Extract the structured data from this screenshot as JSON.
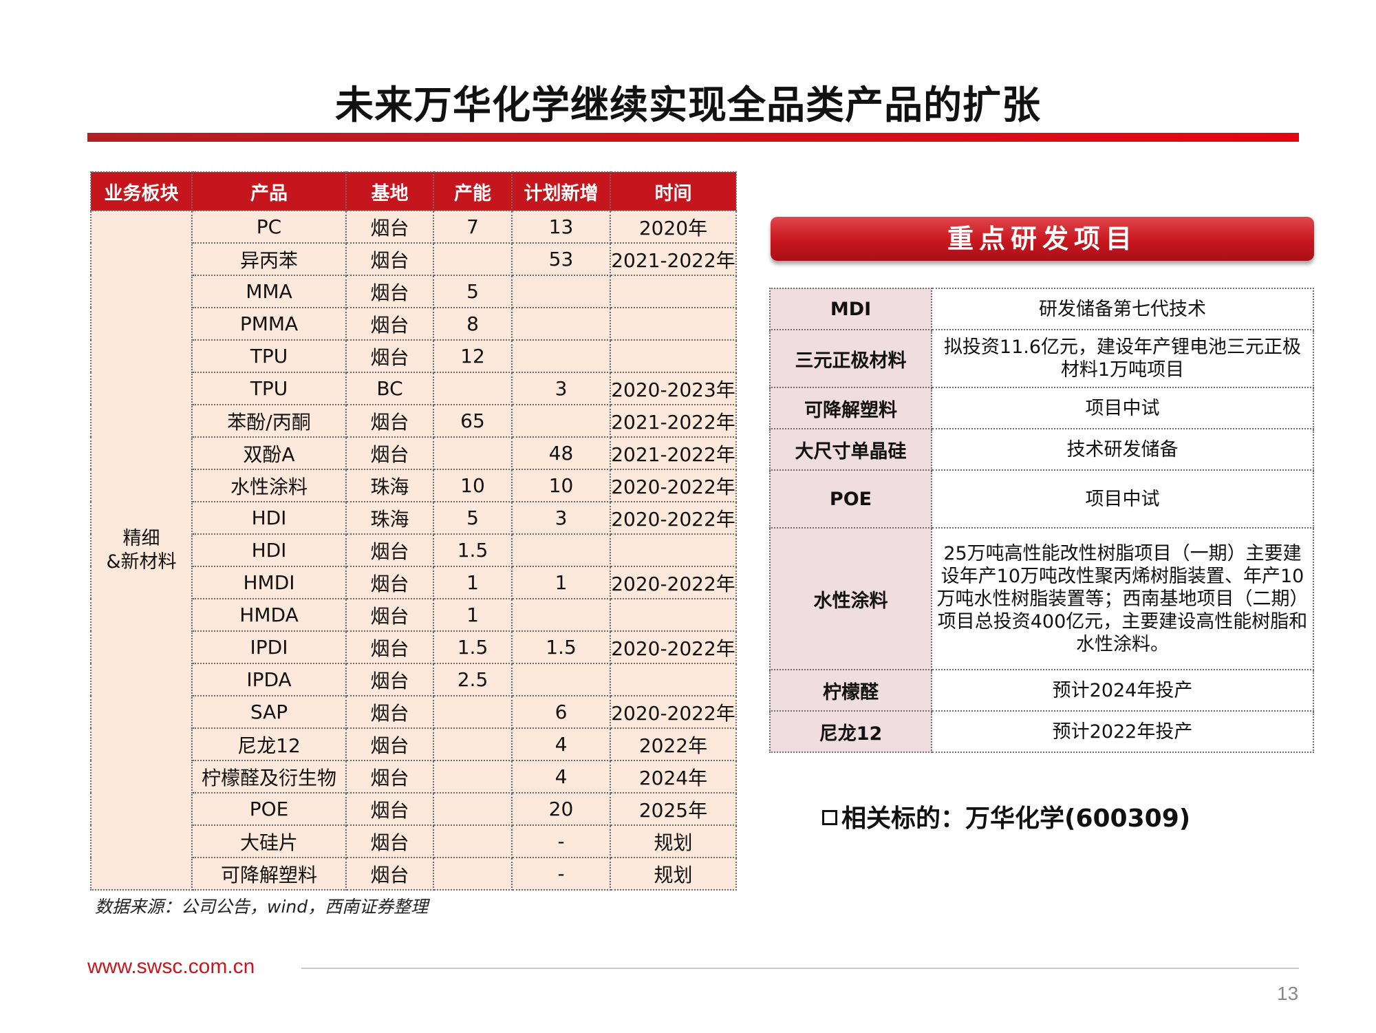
{
  "title": "未来万华化学继续实现全品类产品的扩张",
  "left_table": {
    "headers": [
      "业务板块",
      "产品",
      "基地",
      "产能",
      "计划新增",
      "时间"
    ],
    "segment": "精细\n&新材料",
    "rows": [
      [
        "PC",
        "烟台",
        "7",
        "13",
        "2020年"
      ],
      [
        "异丙苯",
        "烟台",
        "",
        "53",
        "2021-2022年"
      ],
      [
        "MMA",
        "烟台",
        "5",
        "",
        ""
      ],
      [
        "PMMA",
        "烟台",
        "8",
        "",
        ""
      ],
      [
        "TPU",
        "烟台",
        "12",
        "",
        ""
      ],
      [
        "TPU",
        "BC",
        "",
        "3",
        "2020-2023年"
      ],
      [
        "苯酚/丙酮",
        "烟台",
        "65",
        "",
        "2021-2022年"
      ],
      [
        "双酚A",
        "烟台",
        "",
        "48",
        "2021-2022年"
      ],
      [
        "水性涂料",
        "珠海",
        "10",
        "10",
        "2020-2022年"
      ],
      [
        "HDI",
        "珠海",
        "5",
        "3",
        "2020-2022年"
      ],
      [
        "HDI",
        "烟台",
        "1.5",
        "",
        ""
      ],
      [
        "HMDI",
        "烟台",
        "1",
        "1",
        "2020-2022年"
      ],
      [
        "HMDA",
        "烟台",
        "1",
        "",
        ""
      ],
      [
        "IPDI",
        "烟台",
        "1.5",
        "1.5",
        "2020-2022年"
      ],
      [
        "IPDA",
        "烟台",
        "2.5",
        "",
        ""
      ],
      [
        "SAP",
        "烟台",
        "",
        "6",
        "2020-2022年"
      ],
      [
        "尼龙12",
        "烟台",
        "",
        "4",
        "2022年"
      ],
      [
        "柠檬醛及衍生物",
        "烟台",
        "",
        "4",
        "2024年"
      ],
      [
        "POE",
        "烟台",
        "",
        "20",
        "2025年"
      ],
      [
        "大硅片",
        "烟台",
        "",
        "-",
        "规划"
      ],
      [
        "可降解塑料",
        "烟台",
        "",
        "-",
        "规划"
      ]
    ]
  },
  "source": "数据来源：公司公告，wind，西南证券整理",
  "rd_header": "重点研发项目",
  "rd_rows": [
    {
      "key": "MDI",
      "value": "研发储备第七代技术"
    },
    {
      "key": "三元正极材料",
      "value": "拟投资11.6亿元，建设年产锂电池三元正极材料1万吨项目"
    },
    {
      "key": "可降解塑料",
      "value": "项目中试"
    },
    {
      "key": "大尺寸单晶硅",
      "value": "技术研发储备"
    },
    {
      "key": "POE",
      "value": "项目中试"
    },
    {
      "key": "水性涂料",
      "value": "25万吨高性能改性树脂项目（一期）主要建设年产10万吨改性聚丙烯树脂装置、年产10万吨水性树脂装置等；西南基地项目（二期）项目总投资400亿元，主要建设高性能树脂和水性涂料。"
    },
    {
      "key": "柠檬醛",
      "value": "预计2024年投产"
    },
    {
      "key": "尼龙12",
      "value": "预计2022年投产"
    }
  ],
  "related": "相关标的：万华化学(600309)",
  "footer_url": "www.swsc.com.cn",
  "page_number": "13",
  "colors": {
    "brand_red": "#c8161d",
    "table_fill": "#fce9dc",
    "key_fill": "#f0dde0"
  }
}
